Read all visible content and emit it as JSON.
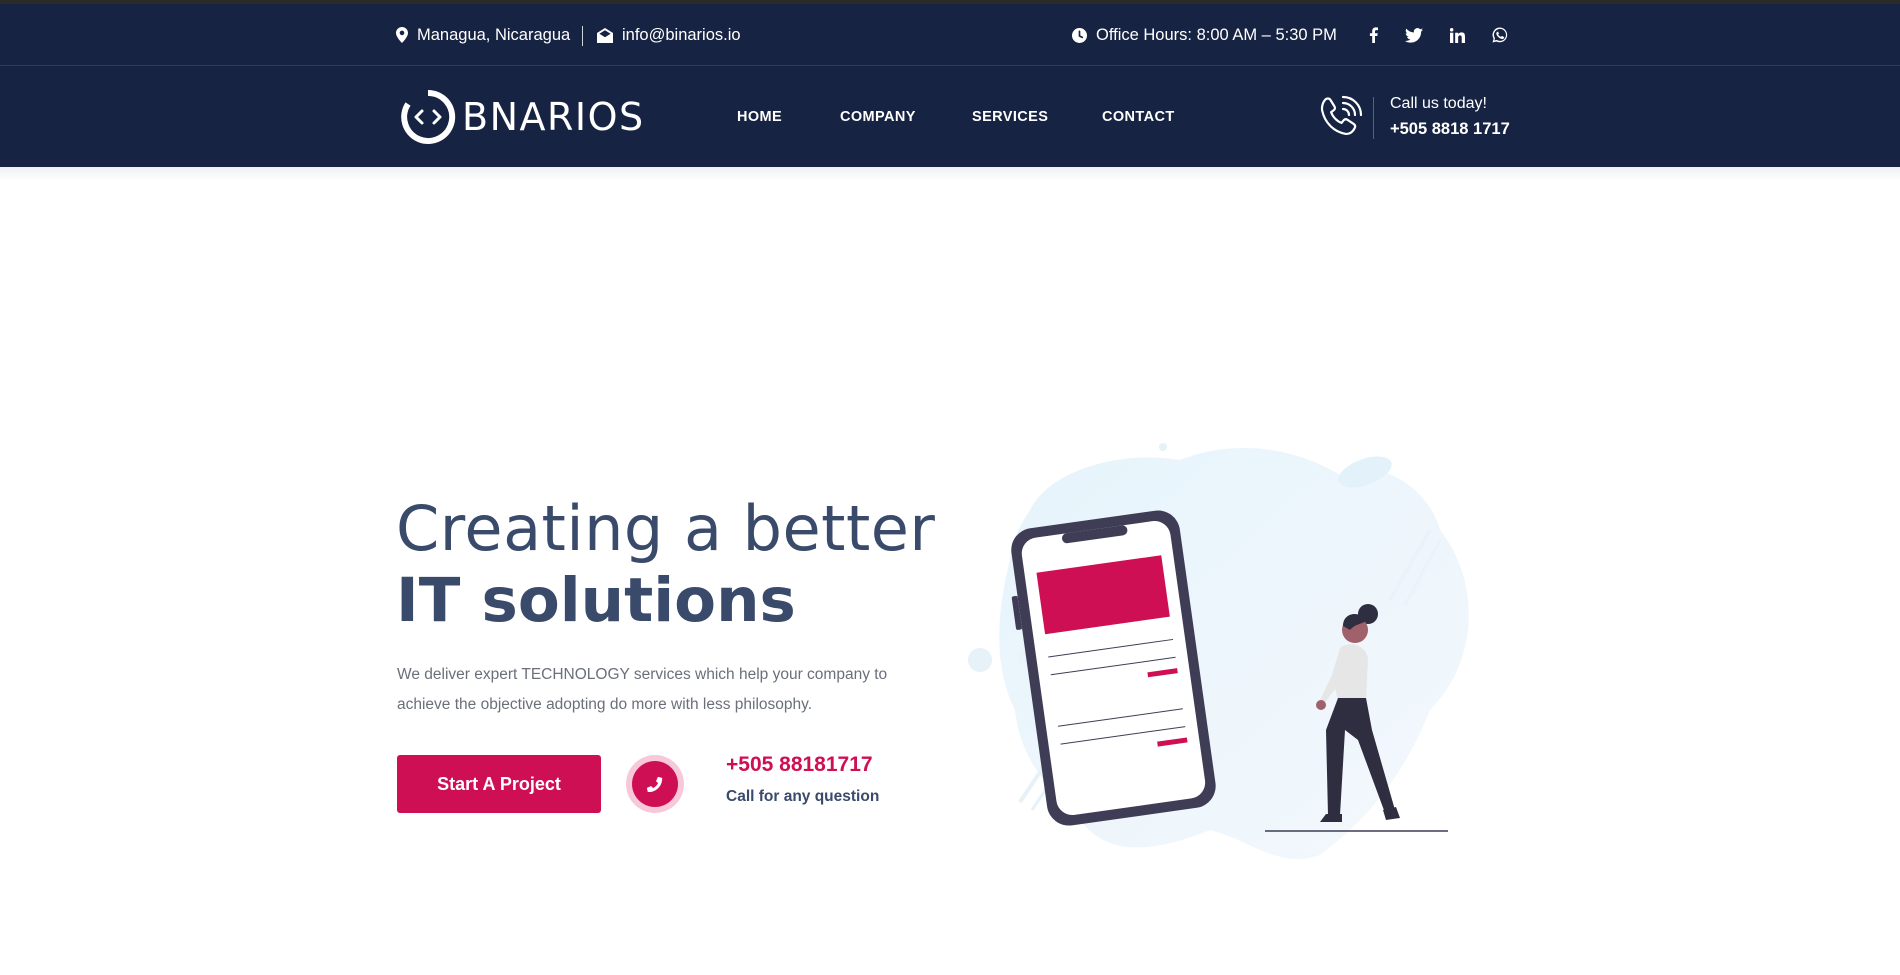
{
  "topbar": {
    "location": "Managua, Nicaragua",
    "email": "info@binarios.io",
    "office_hours": "Office Hours: 8:00 AM – 5:30 PM",
    "social": [
      "facebook-icon",
      "twitter-icon",
      "linkedin-icon",
      "whatsapp-icon"
    ]
  },
  "nav": {
    "logo_text": "BNARIOS",
    "links": [
      "HOME",
      "COMPANY",
      "SERVICES",
      "CONTACT"
    ],
    "call_label": "Call us today!",
    "call_number": "+505 8818 1717"
  },
  "hero": {
    "title_line1": "Creating a better",
    "title_line2": "IT solutions",
    "description": "We deliver expert TECHNOLOGY services which help your company to achieve the objective adopting do more with less philosophy.",
    "cta_label": "Start A Project",
    "phone": "+505 88181717",
    "phone_caption": "Call for any question"
  },
  "colors": {
    "navy": "#172342",
    "accent": "#cf0f54",
    "heading": "#3a4a6b"
  }
}
